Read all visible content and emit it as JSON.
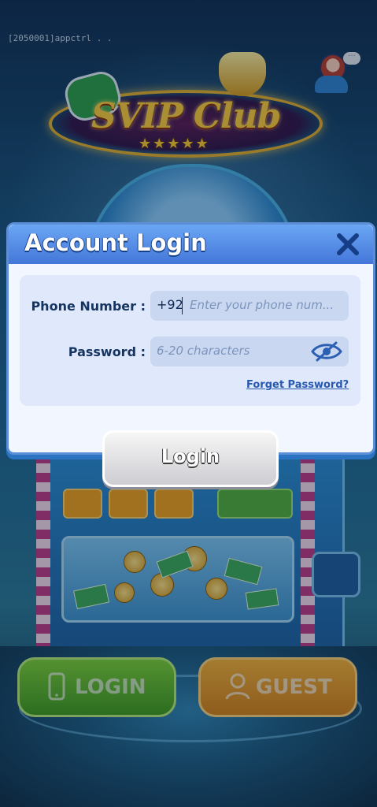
{
  "debug_label": "[2050001]appctrl . .",
  "logo": {
    "text": "SVIP Club",
    "stars": "★★★★★"
  },
  "dialog": {
    "title": "Account Login",
    "phone_label": "Phone Number :",
    "phone_prefix": "+92",
    "phone_placeholder": "Enter your phone num...",
    "password_label": "Password :",
    "password_placeholder": "6-20 characters",
    "forget_link": "Forget Password?",
    "login_button": "Login"
  },
  "bottom_buttons": {
    "login_label": "LOGIN",
    "guest_label": "GUEST"
  }
}
